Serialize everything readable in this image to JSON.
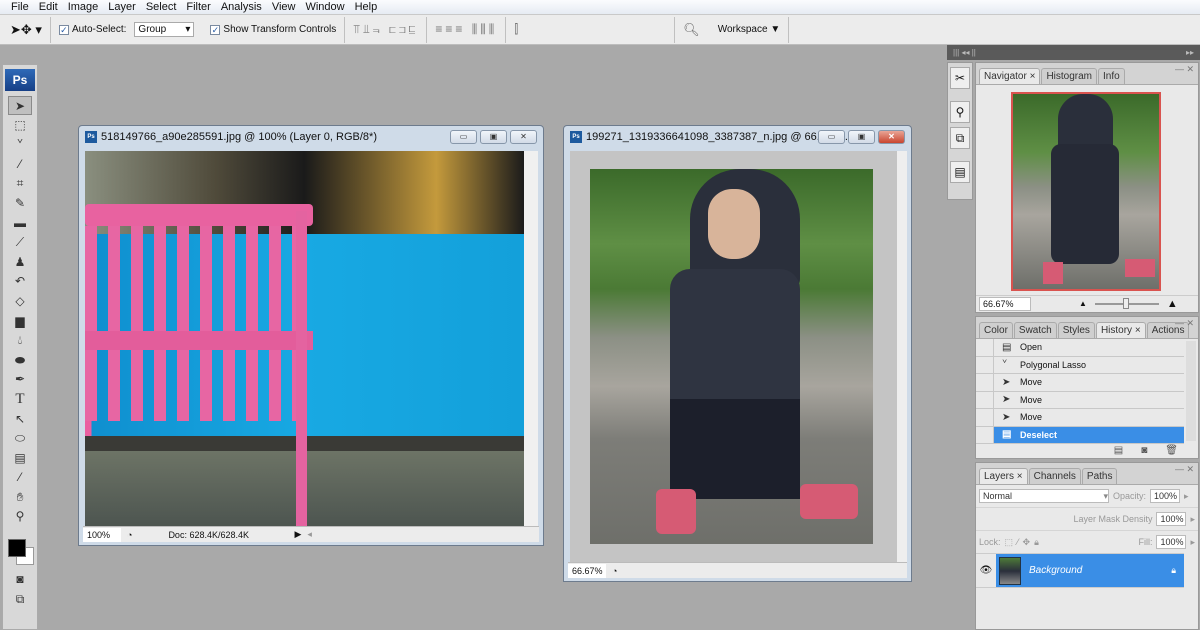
{
  "menu": [
    "File",
    "Edit",
    "Image",
    "Layer",
    "Select",
    "Filter",
    "Analysis",
    "View",
    "Window",
    "Help"
  ],
  "options": {
    "auto_select_label": "Auto-Select:",
    "auto_select_checked": true,
    "auto_select_value": "Group",
    "show_transform_label": "Show Transform Controls",
    "show_transform_checked": true,
    "workspace_label": "Workspace"
  },
  "toolbar": {
    "logo": "Ps",
    "tools": [
      "move",
      "rectangular-marquee",
      "lasso",
      "magic-wand",
      "crop",
      "slice",
      "healing-brush",
      "brush",
      "clone-stamp",
      "history-brush",
      "eraser",
      "gradient",
      "blur",
      "dodge",
      "pen",
      "type",
      "path-selection",
      "ellipse",
      "notes",
      "eyedropper",
      "hand",
      "zoom"
    ]
  },
  "documents": [
    {
      "title": "518149766_a90e285591.jpg @ 100% (Layer 0, RGB/8*)",
      "zoom": "100%",
      "doc_info": "Doc: 628.4K/628.4K"
    },
    {
      "title": "199271_1319336641098_3387387_n.jpg @ 66.7% ...",
      "zoom": "66.67%"
    }
  ],
  "navigator": {
    "tabs": [
      "Navigator",
      "Histogram",
      "Info"
    ],
    "zoom": "66.67%"
  },
  "history": {
    "tabs": [
      "Color",
      "Swatch",
      "Styles",
      "History",
      "Actions"
    ],
    "items": [
      "Open",
      "Polygonal Lasso",
      "Move",
      "Move",
      "Move",
      "Deselect"
    ],
    "selected": "Deselect"
  },
  "layers": {
    "tabs": [
      "Layers",
      "Channels",
      "Paths"
    ],
    "blend_mode": "Normal",
    "opacity_label": "Opacity:",
    "opacity": "100%",
    "mask_density_label": "Layer Mask Density",
    "mask_density": "100%",
    "lock_label": "Lock:",
    "fill_label": "Fill:",
    "fill": "100%",
    "items": [
      {
        "name": "Background",
        "locked": true,
        "visible": true
      }
    ]
  }
}
